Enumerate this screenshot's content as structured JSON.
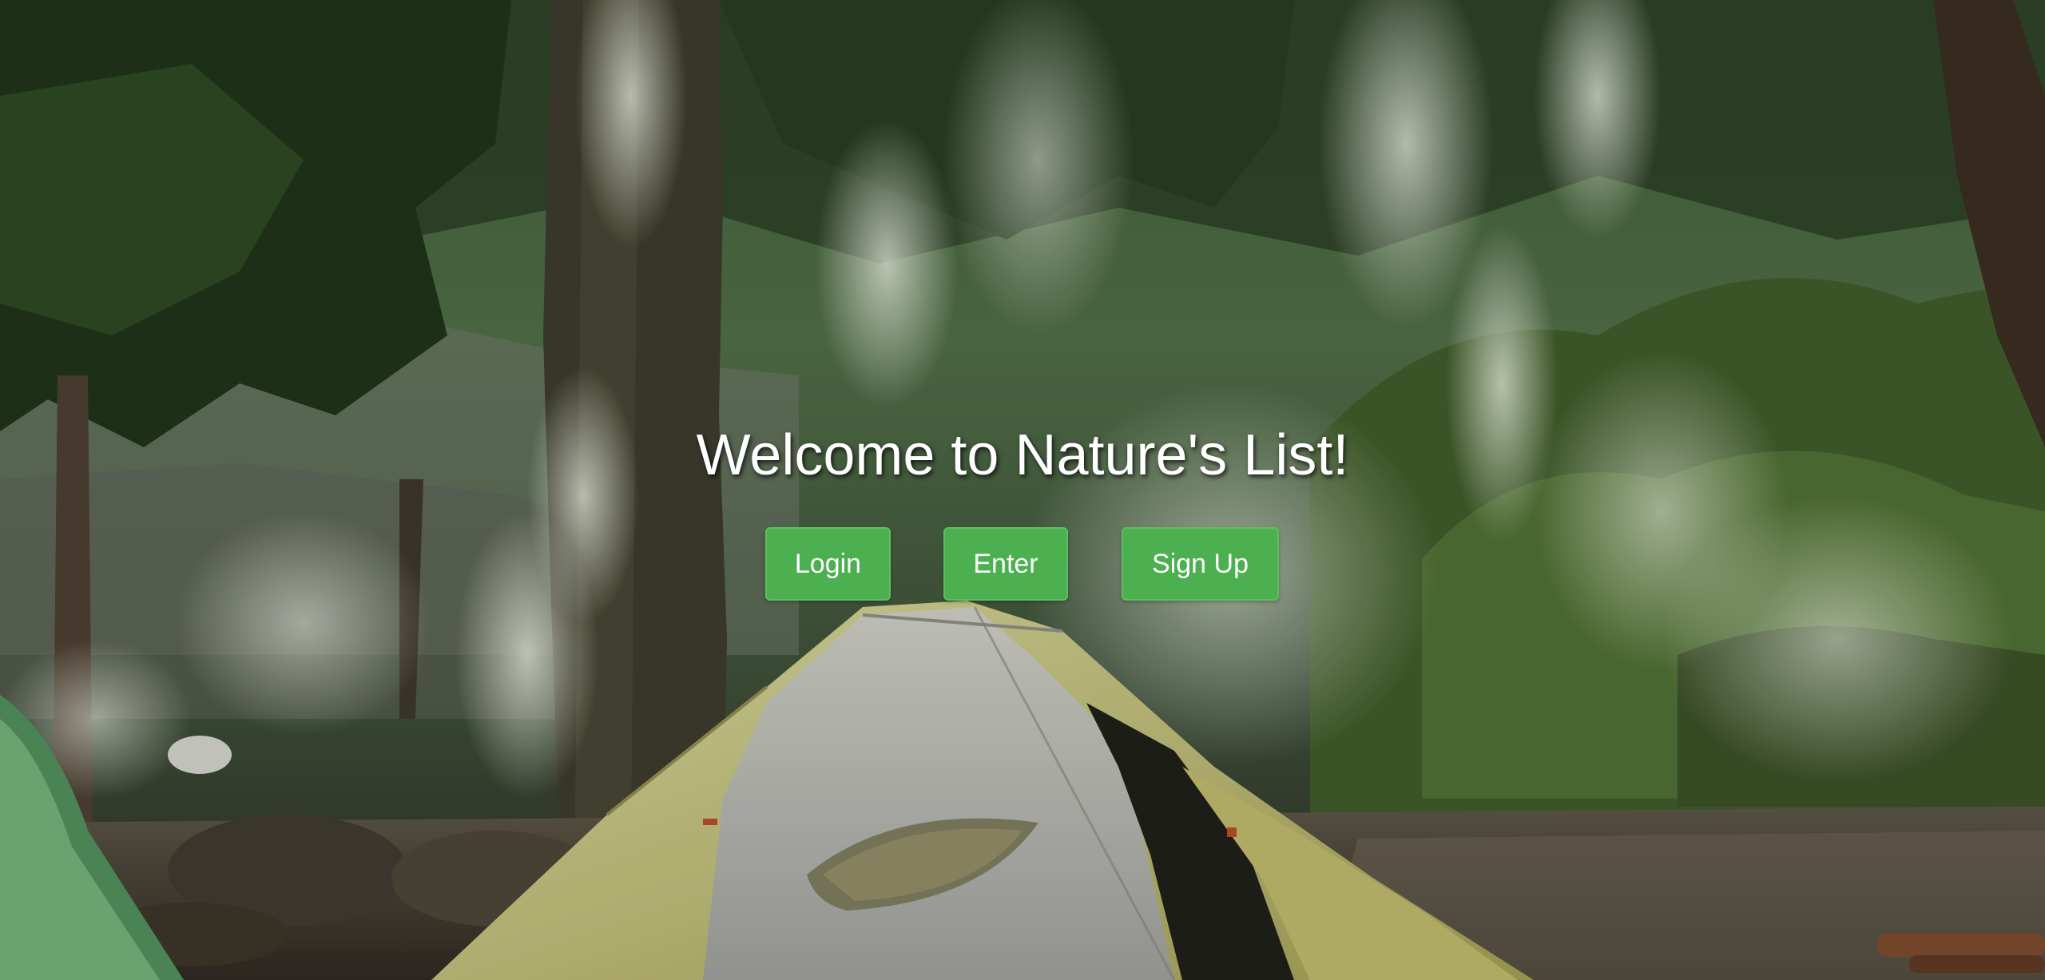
{
  "page": {
    "title": "Welcome to Nature's List!",
    "background": "forest-campsite-photo"
  },
  "actions": {
    "login_label": "Login",
    "enter_label": "Enter",
    "signup_label": "Sign Up"
  },
  "colors": {
    "button_bg": "#4caf50",
    "button_text": "#ffffff",
    "title_text": "#ffffff"
  }
}
